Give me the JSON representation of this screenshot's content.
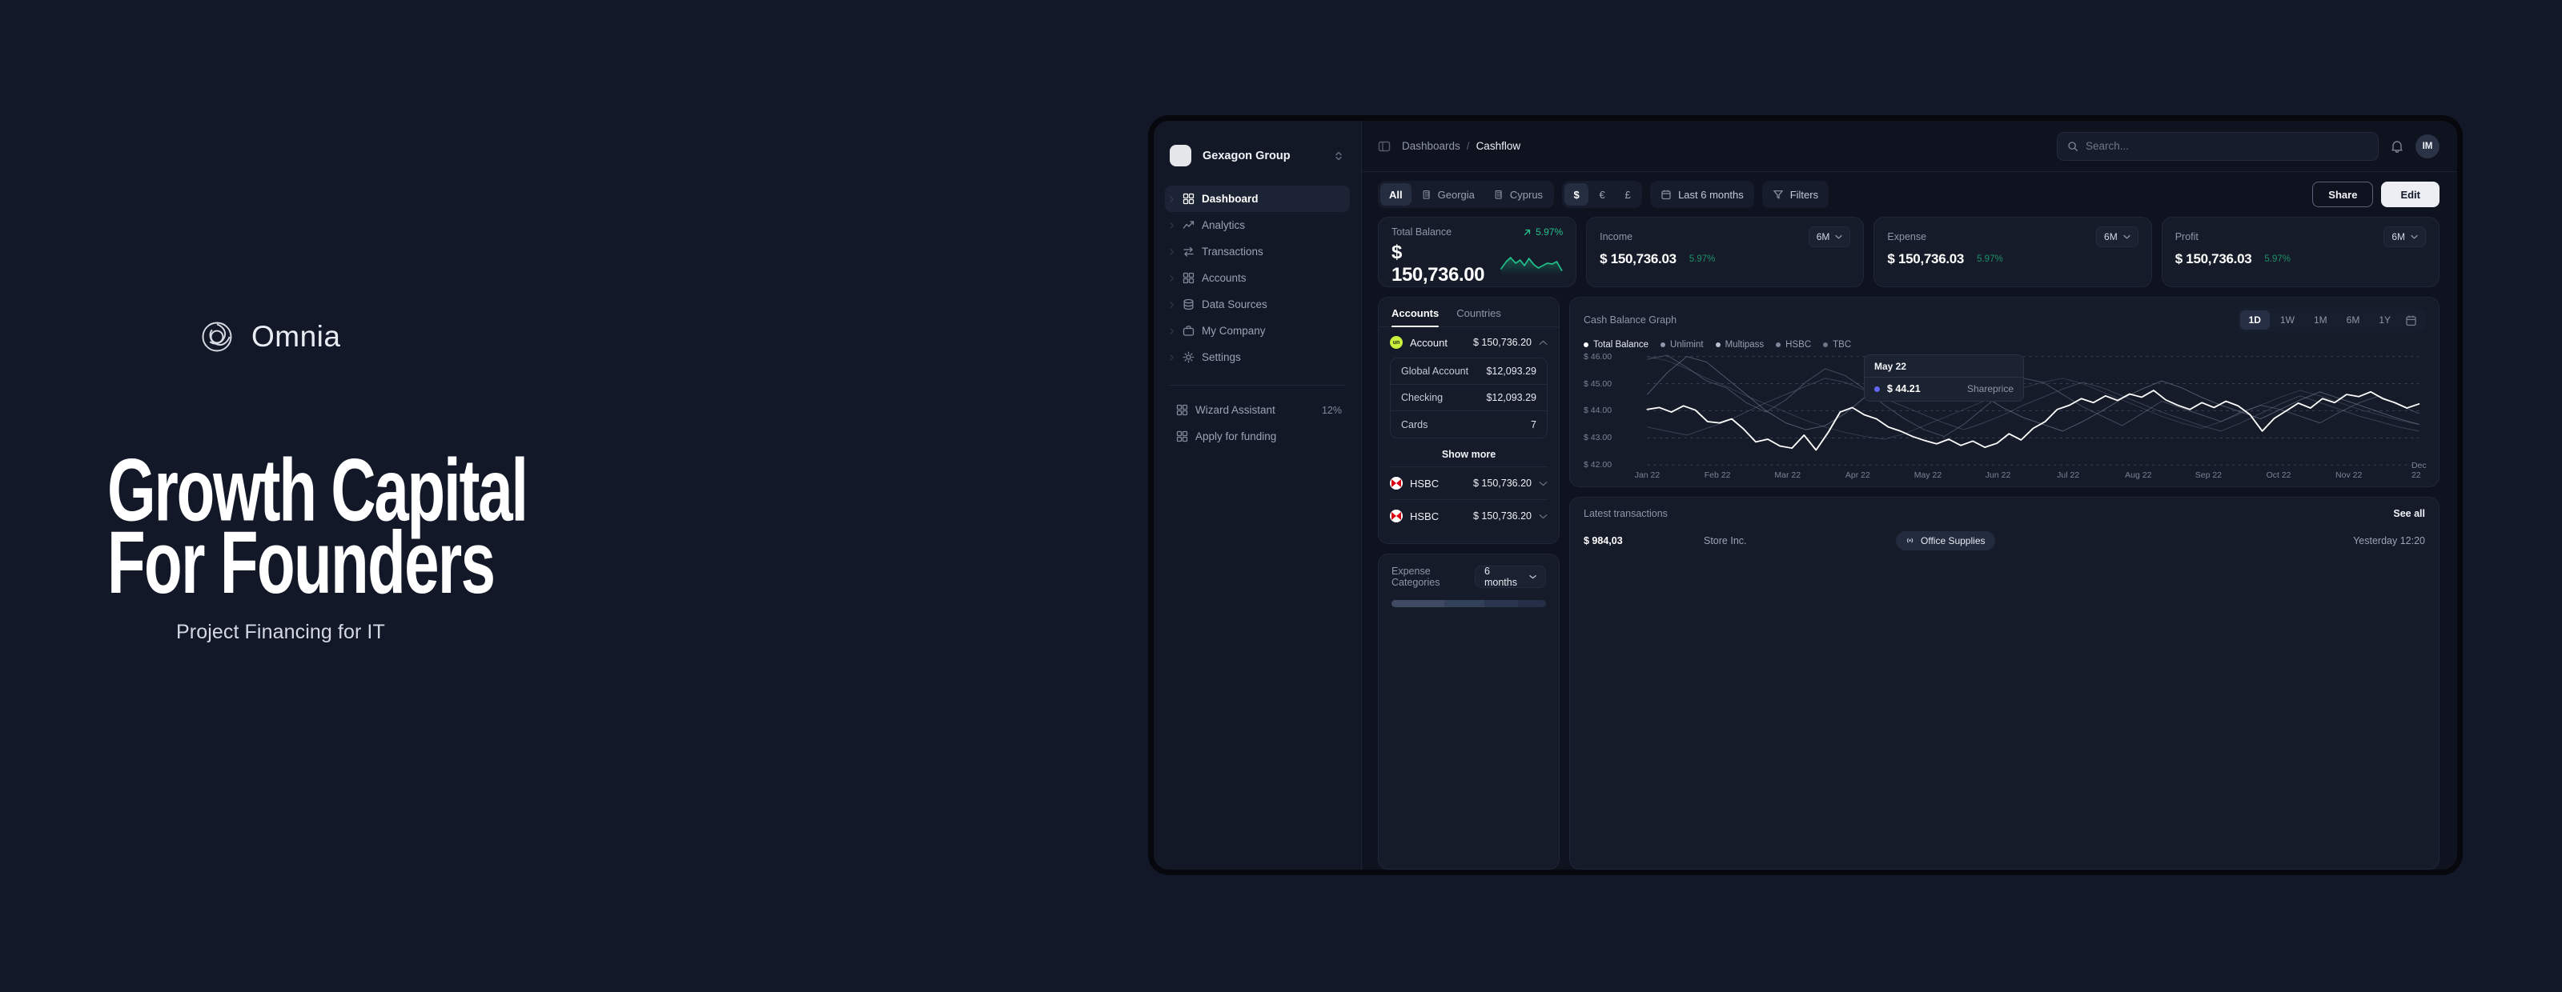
{
  "brand": {
    "logo_icon": "omnia-spiral-logo-icon",
    "logo_text": "Omnia",
    "headline_line1": "Growth Capital",
    "headline_line2": "For Founders",
    "subtitle": "Project Financing for IT"
  },
  "sidebar": {
    "org_name": "Gexagon Group",
    "org_switcher_icon": "chevron-up-down-icon",
    "items": [
      {
        "label": "Dashboard",
        "icon": "grid-icon",
        "active": true
      },
      {
        "label": "Analytics",
        "icon": "trend-up-icon",
        "active": false
      },
      {
        "label": "Transactions",
        "icon": "transfer-icon",
        "active": false
      },
      {
        "label": "Accounts",
        "icon": "grid-icon",
        "active": false
      },
      {
        "label": "Data Sources",
        "icon": "database-icon",
        "active": false
      },
      {
        "label": "My Company",
        "icon": "briefcase-icon",
        "active": false
      },
      {
        "label": "Settings",
        "icon": "gear-icon",
        "active": false
      }
    ],
    "footer_items": [
      {
        "label": "Wizard Assistant",
        "icon": "grid-icon",
        "badge": "12%"
      },
      {
        "label": "Apply for funding",
        "icon": "grid-icon",
        "badge": ""
      }
    ]
  },
  "topbar": {
    "panel_toggle_icon": "panel-toggle-icon",
    "breadcrumb_root": "Dashboards",
    "breadcrumb_sep": "/",
    "breadcrumb_current": "Cashflow",
    "search_placeholder": "Search...",
    "search_value": "",
    "search_icon": "search-icon",
    "bell_icon": "bell-icon",
    "avatar_initials": "IM"
  },
  "filterbar": {
    "locations": [
      {
        "label": "All",
        "icon": "",
        "active": true
      },
      {
        "label": "Georgia",
        "icon": "building-icon",
        "active": false
      },
      {
        "label": "Cyprus",
        "icon": "building-icon",
        "active": false
      }
    ],
    "currencies": [
      {
        "label": "$",
        "active": true
      },
      {
        "label": "€",
        "active": false
      },
      {
        "label": "£",
        "active": false
      }
    ],
    "date_range": "Last 6 months",
    "date_icon": "calendar-icon",
    "filters_label": "Filters",
    "filters_icon": "funnel-icon",
    "share_label": "Share",
    "edit_label": "Edit"
  },
  "kpis": {
    "total": {
      "label": "Total Balance",
      "value": "$ 150,736.00",
      "delta": "5.97%",
      "delta_icon": "arrow-up-right-icon",
      "sparkline_color": "#22c08a"
    },
    "cards": [
      {
        "label": "Income",
        "period": "6M",
        "value": "$ 150,736.03",
        "delta": "5.97%"
      },
      {
        "label": "Expense",
        "period": "6M",
        "value": "$ 150,736.03",
        "delta": "5.97%"
      },
      {
        "label": "Profit",
        "period": "6M",
        "value": "$ 150,736.03",
        "delta": "5.97%"
      }
    ]
  },
  "accounts": {
    "tabs": [
      {
        "label": "Accounts",
        "active": true
      },
      {
        "label": "Countries",
        "active": false
      }
    ],
    "primary": {
      "name": "Account",
      "amount": "$ 150,736.20",
      "badge_text": "un",
      "badge_color": "#c8f03c",
      "chevron": "chevron-up-icon",
      "sub_rows": [
        {
          "label": "Global Account",
          "value": "$12,093.29"
        },
        {
          "label": "Checking",
          "value": "$12,093.29"
        },
        {
          "label": "Cards",
          "value": "7"
        }
      ]
    },
    "show_more_label": "Show more",
    "banks": [
      {
        "name": "HSBC",
        "amount": "$ 150,736.20",
        "badge_color": "#db0011",
        "chevron": "chevron-down-icon"
      },
      {
        "name": "HSBC",
        "amount": "$ 150,736.20",
        "badge_color": "#db0011",
        "chevron": "chevron-down-icon"
      }
    ]
  },
  "expense_categories": {
    "title": "Expense Categories",
    "period": "6 months",
    "period_icon": "chevron-down-icon",
    "segments": [
      {
        "color": "#3e4a63",
        "pct": 34
      },
      {
        "color": "#32405a",
        "pct": 26
      },
      {
        "color": "#2a3550",
        "pct": 22
      },
      {
        "color": "#242e47",
        "pct": 18
      }
    ]
  },
  "chart_card": {
    "title": "Cash Balance Graph",
    "ranges": [
      {
        "label": "1D",
        "active": true
      },
      {
        "label": "1W",
        "active": false
      },
      {
        "label": "1M",
        "active": false
      },
      {
        "label": "6M",
        "active": false
      },
      {
        "label": "1Y",
        "active": false
      }
    ],
    "calendar_icon": "calendar-icon",
    "tooltip": {
      "date": "May 22",
      "value": "$ 44.21",
      "series": "Shareprice",
      "dot_color": "#6366f1"
    }
  },
  "chart_data": {
    "type": "line",
    "title": "Cash Balance Graph",
    "xlabel": "",
    "ylabel": "",
    "ylim": [
      42.0,
      46.0
    ],
    "y_ticks": [
      "$ 42.00",
      "$ 43.00",
      "$ 44.00",
      "$ 45.00",
      "$ 46.00"
    ],
    "grid": true,
    "legend_position": "top-left",
    "x": [
      "Jan 22",
      "Feb 22",
      "Mar 22",
      "Apr 22",
      "May 22",
      "Jun 22",
      "Jul 22",
      "Aug 22",
      "Sep 22",
      "Oct 22",
      "Nov 22",
      "Dec 22"
    ],
    "legend": [
      {
        "name": "Total Balance",
        "color": "#ffffff"
      },
      {
        "name": "Unlimint",
        "color": "#8d96aa"
      },
      {
        "name": "Multipass",
        "color": "#b9c0cf"
      },
      {
        "name": "HSBC",
        "color": "#7e8799"
      },
      {
        "name": "TBC",
        "color": "#6d768a"
      }
    ],
    "series": [
      {
        "name": "Total Balance",
        "color": "#ffffff",
        "values": [
          44.05,
          44.12,
          43.95,
          44.18,
          44.02,
          43.6,
          43.55,
          43.7,
          43.32,
          42.85,
          42.95,
          42.7,
          42.62,
          43.1,
          42.55,
          43.2,
          43.95,
          44.12,
          43.85,
          43.7,
          43.4,
          43.25,
          43.05,
          42.9,
          42.78,
          42.95,
          42.72,
          42.88,
          42.65,
          42.8,
          43.15,
          42.92,
          43.35,
          43.6,
          44.05,
          44.2,
          44.45,
          44.3,
          44.55,
          44.38,
          44.62,
          44.5,
          44.75,
          44.4,
          44.2,
          44.05,
          44.3,
          44.12,
          44.35,
          44.18,
          43.85,
          43.25,
          43.72,
          44.0,
          44.28,
          44.1,
          44.45,
          44.3,
          44.6,
          44.52,
          44.7,
          44.45,
          44.3,
          44.1,
          44.25
        ]
      },
      {
        "name": "Unlimint",
        "color": "#6f788c",
        "values": [
          45.9,
          46.05,
          45.6,
          45.1,
          44.85,
          44.3,
          43.95,
          44.4,
          45.05,
          45.55,
          45.3,
          44.8,
          44.2,
          43.7,
          43.3,
          43.05,
          43.5,
          44.1,
          44.7,
          45.2,
          45.05,
          44.6,
          44.15,
          43.8,
          43.45,
          43.9,
          44.35,
          44.1,
          43.85,
          43.6,
          43.95,
          44.2,
          44.05,
          43.8,
          43.55,
          43.95,
          44.3,
          44.55,
          44.2,
          43.9
        ]
      },
      {
        "name": "Multipass",
        "color": "#858ea2",
        "values": [
          44.6,
          45.4,
          46.0,
          45.8,
          45.2,
          44.6,
          44.0,
          43.55,
          43.3,
          43.45,
          43.9,
          44.5,
          45.1,
          45.55,
          45.8,
          45.5,
          45.05,
          44.55,
          44.1,
          43.75,
          43.5,
          43.25,
          43.6,
          44.0,
          44.45,
          44.8,
          45.1,
          44.85,
          44.5,
          44.2,
          43.95,
          43.7,
          44.05,
          44.4,
          44.7,
          44.45,
          44.2,
          43.95,
          43.7,
          43.5
        ]
      },
      {
        "name": "HSBC",
        "color": "#5c6578",
        "values": [
          43.4,
          43.25,
          43.1,
          43.35,
          43.6,
          43.95,
          44.3,
          44.6,
          44.9,
          45.2,
          45.05,
          44.75,
          44.45,
          44.15,
          43.85,
          43.55,
          43.3,
          43.55,
          43.85,
          44.2,
          44.5,
          44.8,
          45.05,
          44.85,
          44.55,
          44.25,
          43.95,
          43.7,
          43.45,
          43.25,
          43.55,
          43.9,
          44.25,
          44.55,
          44.3,
          44.05,
          43.8,
          43.6,
          43.4,
          43.25
        ]
      },
      {
        "name": "TBC",
        "color": "#4f5769",
        "values": [
          46.0,
          45.85,
          45.55,
          45.2,
          44.9,
          44.55,
          44.25,
          43.95,
          43.65,
          43.4,
          43.2,
          43.05,
          42.95,
          43.15,
          43.45,
          43.75,
          44.05,
          44.35,
          44.6,
          44.85,
          45.05,
          45.2,
          45.0,
          44.7,
          44.4,
          44.1,
          43.8,
          43.55,
          43.35,
          43.6,
          43.9,
          44.2,
          44.5,
          44.75,
          44.55,
          44.3,
          44.05,
          43.85,
          43.65,
          43.5
        ]
      }
    ]
  },
  "transactions": {
    "title": "Latest transactions",
    "see_all_label": "See all",
    "rows": [
      {
        "amount": "$ 984,03",
        "merchant": "Store Inc.",
        "category": "Office Supplies",
        "category_icon": "broadcast-icon",
        "time": "Yesterday 12:20"
      }
    ]
  }
}
